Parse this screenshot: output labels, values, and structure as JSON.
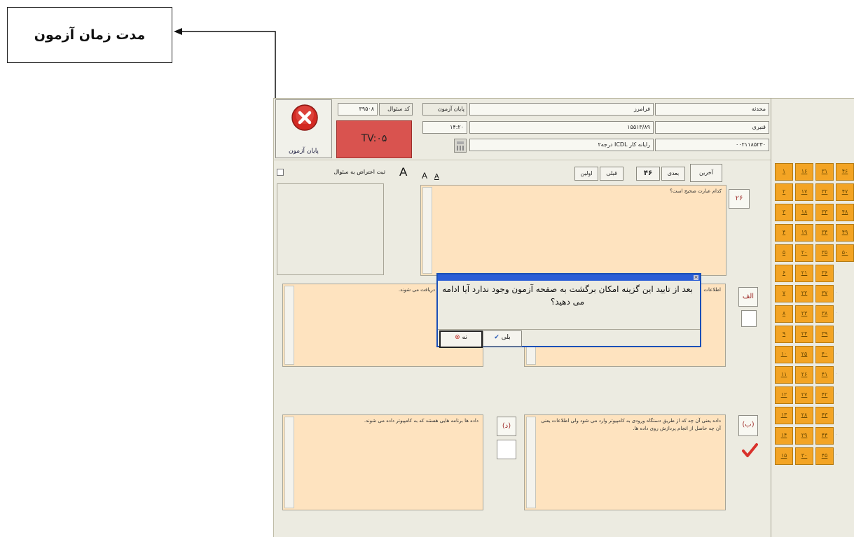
{
  "callout": {
    "label": "مدت زمان آزمون"
  },
  "header": {
    "end_exam_label": "پایان آزمون",
    "timer": "TV:۰۵",
    "question_code_label": "کد سئوال",
    "question_code_value": "۳۹۵۰۸",
    "end_time_label": "پایان آزمون",
    "end_time_value": "۱۴:۲۰",
    "info_row1_label": "فرامرز",
    "info_row1_right": "محدثه",
    "info_row2_label": "۱۵۵۱۳/۸۹",
    "info_row2_right": "قنبری",
    "info_row3_label": "رایانه کار ICDL درجه۲",
    "info_row3_right": "۰۰۲۱۱۸۵۲۳۰"
  },
  "nav": {
    "last": "آخرین",
    "next": "بعدی",
    "current": "۴۶",
    "prev": "قبلی",
    "first": "اولین"
  },
  "font_sizes": {
    "large": "A",
    "medium": "A",
    "small": "A"
  },
  "objection": {
    "label": "ثبت اعتراض به سئوال"
  },
  "question": {
    "number": "۲۶",
    "text": "کدام عبارت صحیح است؟"
  },
  "options": {
    "alef": {
      "label": "الف",
      "text": "اطلاعات"
    },
    "b": {
      "label": "(ب)",
      "text": "داده یعنی آن چه که از طریق دستگاه ورودی به کامپیوتر وارد می شود ولی اطلاعات یعنی آن چه حاصل از انجام پردازش روی داده ها."
    },
    "j_text": "هستند که از کامپیوتر دریافت می شوند.",
    "d": {
      "label": "(د)",
      "text": "داده ها برنامه هایی هستند که به کامپیوتر داده می شوند."
    }
  },
  "dialog": {
    "message": "بعد از تایید این گزینه امکان برگشت به صفحه آزمون وجود ندارد آیا ادامه می دهید؟",
    "no_label": "نه",
    "yes_label": "بلی"
  },
  "grid": {
    "rows": [
      [
        "۱",
        "۱۶",
        "۳۱",
        "۴۶"
      ],
      [
        "۲",
        "۱۷",
        "۳۲",
        "۴۷"
      ],
      [
        "۳",
        "۱۸",
        "۳۳",
        "۴۸"
      ],
      [
        "۴",
        "۱۹",
        "۳۴",
        "۴۹"
      ],
      [
        "۵",
        "۲۰",
        "۳۵",
        "۵۰"
      ],
      [
        "۶",
        "۲۱",
        "۳۶",
        ""
      ],
      [
        "۷",
        "۲۲",
        "۳۷",
        ""
      ],
      [
        "۸",
        "۲۳",
        "۳۸",
        ""
      ],
      [
        "۹",
        "۲۴",
        "۳۹",
        ""
      ],
      [
        "۱۰",
        "۲۵",
        "۴۰",
        ""
      ],
      [
        "۱۱",
        "۲۶",
        "۴۱",
        ""
      ],
      [
        "۱۲",
        "۲۷",
        "۴۲",
        ""
      ],
      [
        "۱۳",
        "۲۸",
        "۴۳",
        ""
      ],
      [
        "۱۴",
        "۲۹",
        "۴۴",
        ""
      ],
      [
        "۱۵",
        "۳۰",
        "۴۵",
        ""
      ]
    ]
  },
  "colors": {
    "accent_orange": "#f3a424",
    "timer_bg": "#d9534f",
    "answer_bg": "#fee3bf",
    "dialog_border": "#1a4fb8"
  }
}
